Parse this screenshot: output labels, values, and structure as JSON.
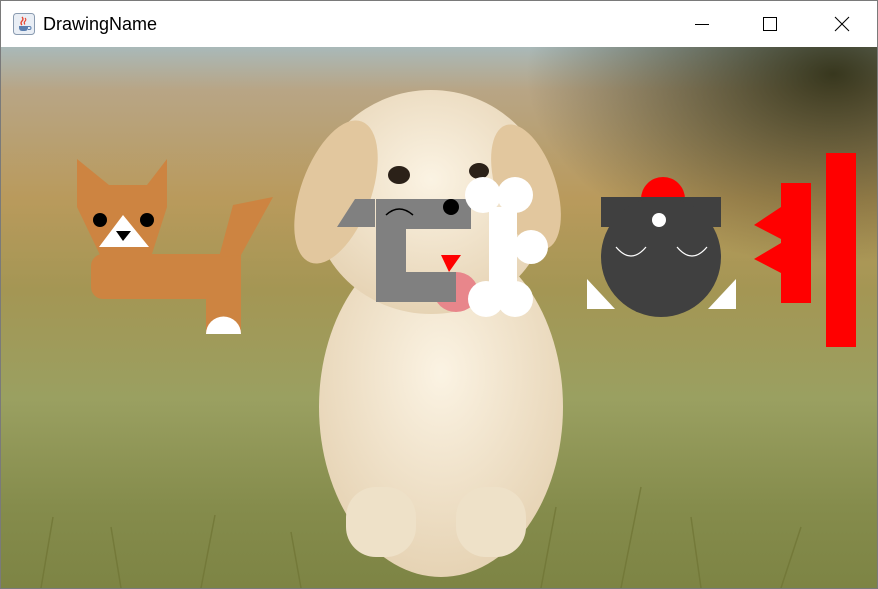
{
  "window": {
    "title": "DrawingName",
    "controls": {
      "minimize": "minimize-icon",
      "maximize": "maximize-icon",
      "close": "close-icon"
    }
  },
  "icons": {
    "app": "java-coffee-cup-icon"
  },
  "colors": {
    "cat": "#cd8441",
    "white": "#ffffff",
    "black": "#000000",
    "gray": "#808080",
    "dark_gray": "#404040",
    "red": "#ff0000",
    "sky": "#9bb1b6",
    "grass": "#8c9a4c"
  }
}
